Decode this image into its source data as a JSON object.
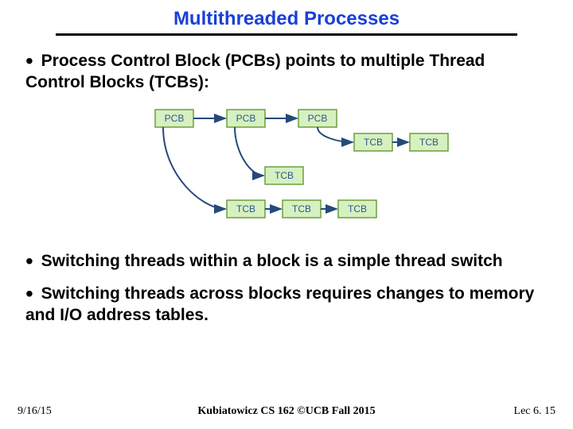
{
  "title": "Multithreaded Processes",
  "bullets": {
    "b1": "Process Control Block (PCBs) points to multiple Thread Control Blocks (TCBs):",
    "b2": "Switching threads within a block is a simple thread switch",
    "b3": "Switching threads across blocks requires changes to memory and I/O address tables."
  },
  "diagram": {
    "pcb": "PCB",
    "tcb": "TCB"
  },
  "footer": {
    "left": "9/16/15",
    "center": "Kubiatowicz CS 162 ©UCB Fall 2015",
    "right": "Lec 6. 15"
  }
}
